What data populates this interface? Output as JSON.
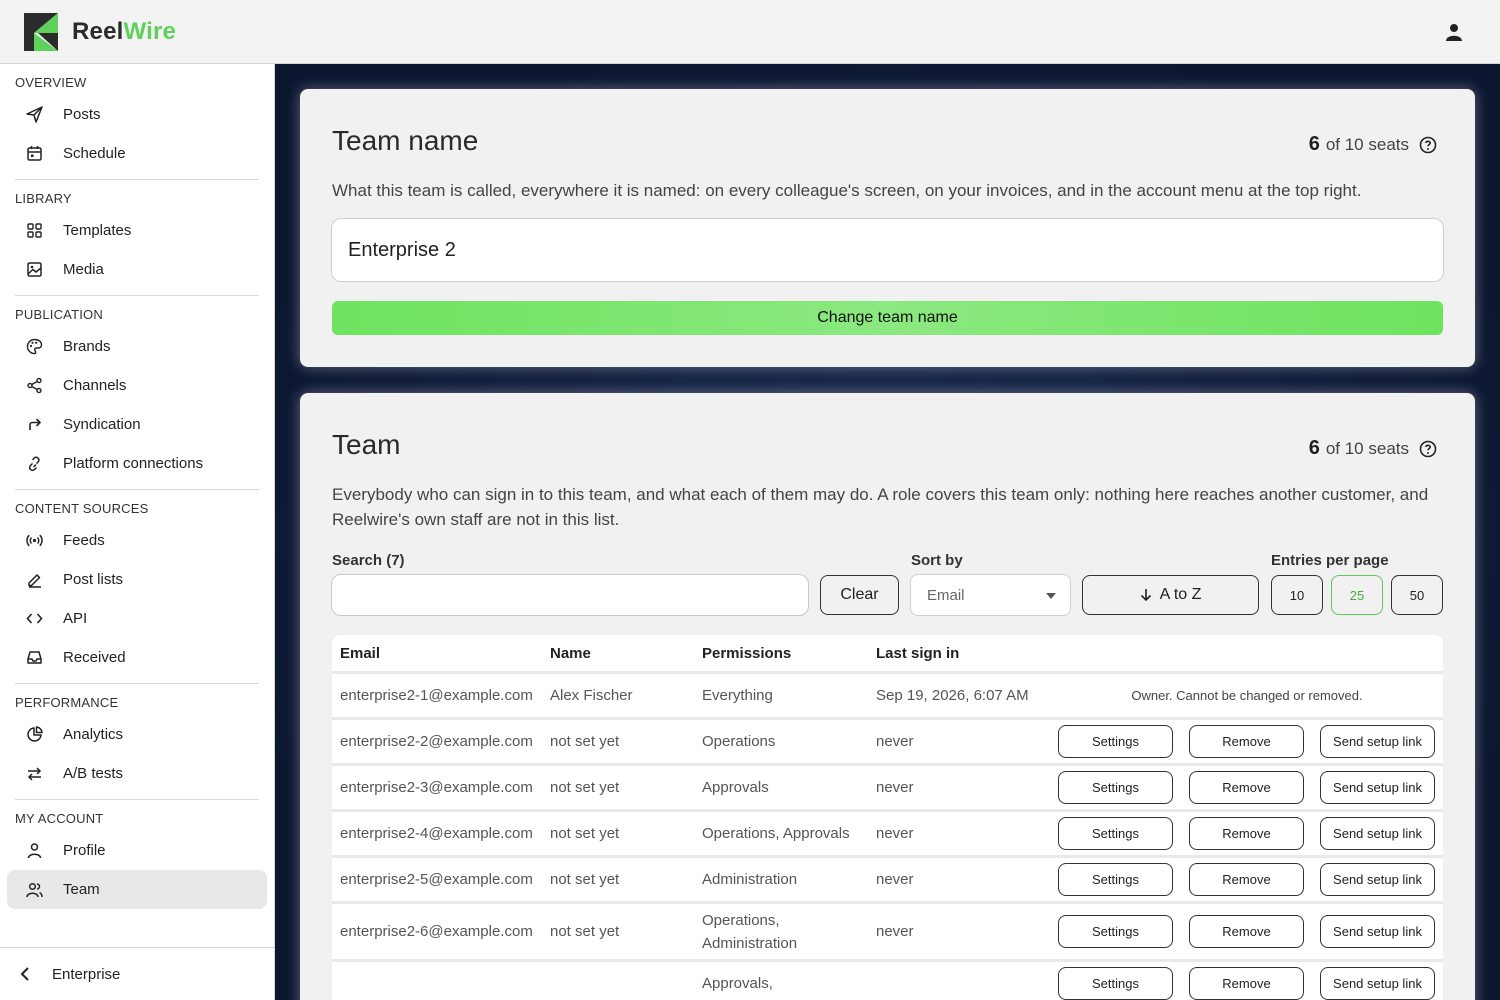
{
  "app": {
    "brand_part1": "Reel",
    "brand_part2": "Wire",
    "accent": "#5fd05a"
  },
  "sidebar": {
    "sections": [
      {
        "title": "OVERVIEW",
        "items": [
          {
            "label": "Posts",
            "icon": "send-icon"
          },
          {
            "label": "Schedule",
            "icon": "calendar-icon"
          }
        ]
      },
      {
        "title": "LIBRARY",
        "items": [
          {
            "label": "Templates",
            "icon": "grid-icon"
          },
          {
            "label": "Media",
            "icon": "image-icon"
          }
        ]
      },
      {
        "title": "PUBLICATION",
        "items": [
          {
            "label": "Brands",
            "icon": "palette-icon"
          },
          {
            "label": "Channels",
            "icon": "share-icon"
          },
          {
            "label": "Syndication",
            "icon": "forward-arrow-icon"
          },
          {
            "label": "Platform connections",
            "icon": "link-icon"
          }
        ]
      },
      {
        "title": "CONTENT SOURCES",
        "items": [
          {
            "label": "Feeds",
            "icon": "broadcast-icon"
          },
          {
            "label": "Post lists",
            "icon": "pencil-icon"
          },
          {
            "label": "API",
            "icon": "code-icon"
          },
          {
            "label": "Received",
            "icon": "inbox-icon"
          }
        ]
      },
      {
        "title": "PERFORMANCE",
        "items": [
          {
            "label": "Analytics",
            "icon": "pie-chart-icon"
          },
          {
            "label": "A/B tests",
            "icon": "swap-icon"
          }
        ]
      },
      {
        "title": "MY ACCOUNT",
        "items": [
          {
            "label": "Profile",
            "icon": "user-icon"
          },
          {
            "label": "Team",
            "icon": "users-icon",
            "active": true
          }
        ]
      }
    ],
    "footer_label": "Enterprise"
  },
  "team_name_card": {
    "title": "Team name",
    "seats_used": "6",
    "seats_text": "of 10 seats",
    "description": "What this team is called, everywhere it is named: on every colleague's screen, on your invoices, and in the account menu at the top right.",
    "name_value": "Enterprise 2",
    "button_label": "Change team name"
  },
  "team_card": {
    "title": "Team",
    "seats_used": "6",
    "seats_text": "of 10 seats",
    "description": "Everybody who can sign in to this team, and what each of them may do. A role covers this team only: nothing here reaches another customer, and Reelwire's own staff are not in this list.",
    "search_label": "Search (7)",
    "search_value": "",
    "clear_label": "Clear",
    "sort_label": "Sort by",
    "sort_value": "Email",
    "order_label": "A to Z",
    "entries_label": "Entries per page",
    "entries_options": [
      "10",
      "25",
      "50"
    ],
    "entries_selected": "25",
    "columns": [
      "Email",
      "Name",
      "Permissions",
      "Last sign in"
    ],
    "owner_note": "Owner. Cannot be changed or removed.",
    "action_labels": {
      "settings": "Settings",
      "remove": "Remove",
      "setup": "Send setup link"
    },
    "rows": [
      {
        "email": "enterprise2-1@example.com",
        "name": "Alex Fischer",
        "permissions": "Everything",
        "last": "Sep 19, 2026, 6:07 AM",
        "owner": true
      },
      {
        "email": "enterprise2-2@example.com",
        "name": "not set yet",
        "permissions": "Operations",
        "last": "never"
      },
      {
        "email": "enterprise2-3@example.com",
        "name": "not set yet",
        "permissions": "Approvals",
        "last": "never"
      },
      {
        "email": "enterprise2-4@example.com",
        "name": "not set yet",
        "permissions": "Operations, Approvals",
        "last": "never"
      },
      {
        "email": "enterprise2-5@example.com",
        "name": "not set yet",
        "permissions": "Administration",
        "last": "never"
      },
      {
        "email": "enterprise2-6@example.com",
        "name": "not set yet",
        "permissions": "Operations, Administration",
        "last": "never"
      },
      {
        "email": "",
        "name": "",
        "permissions": "Approvals,",
        "last": ""
      }
    ]
  }
}
